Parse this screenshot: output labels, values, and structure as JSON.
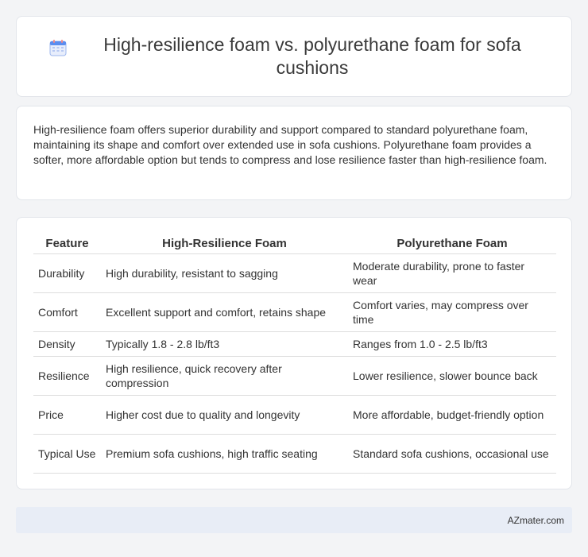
{
  "title": "High-resilience foam vs. polyurethane foam for sofa cushions",
  "summary": "High-resilience foam offers superior durability and support compared to standard polyurethane foam, maintaining its shape and comfort over extended use in sofa cushions. Polyurethane foam provides a softer, more affordable option but tends to compress and lose resilience faster than high-resilience foam.",
  "table": {
    "headers": [
      "Feature",
      "High-Resilience Foam",
      "Polyurethane Foam"
    ],
    "rows": [
      [
        "Durability",
        "High durability, resistant to sagging",
        "Moderate durability, prone to faster wear"
      ],
      [
        "Comfort",
        "Excellent support and comfort, retains shape",
        "Comfort varies, may compress over time"
      ],
      [
        "Density",
        "Typically 1.8 - 2.8 lb/ft3",
        "Ranges from 1.0 - 2.5 lb/ft3"
      ],
      [
        "Resilience",
        "High resilience, quick recovery after compression",
        "Lower resilience, slower bounce back"
      ],
      [
        "Price",
        "Higher cost due to quality and longevity",
        "More affordable, budget-friendly option"
      ],
      [
        "Typical Use",
        "Premium sofa cushions, high traffic seating",
        "Standard sofa cushions, occasional use"
      ]
    ]
  },
  "footer": "AZmater.com",
  "colors": {
    "background": "#f3f4f6",
    "footer_bg": "#e8edf6",
    "icon_accent": "#5b8def"
  },
  "icons": {
    "title": "calendar-icon"
  }
}
